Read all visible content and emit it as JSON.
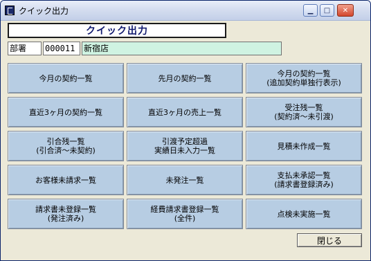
{
  "window": {
    "title": "クイック出力"
  },
  "header": {
    "title": "クイック出力"
  },
  "department": {
    "label": "部署",
    "code": "000011",
    "name": "新宿店"
  },
  "buttons": [
    {
      "line1": "今月の契約一覧",
      "line2": ""
    },
    {
      "line1": "先月の契約一覧",
      "line2": ""
    },
    {
      "line1": "今月の契約一覧",
      "line2": "(追加契約単独行表示)"
    },
    {
      "line1": "直近3ヶ月の契約一覧",
      "line2": ""
    },
    {
      "line1": "直近3ヶ月の売上一覧",
      "line2": ""
    },
    {
      "line1": "受注残一覧",
      "line2": "(契約済～未引渡)"
    },
    {
      "line1": "引合残一覧",
      "line2": "(引合済～未契約)"
    },
    {
      "line1": "引渡予定超過",
      "line2": "実績日未入力一覧"
    },
    {
      "line1": "見積未作成一覧",
      "line2": ""
    },
    {
      "line1": "お客様未請求一覧",
      "line2": ""
    },
    {
      "line1": "未発注一覧",
      "line2": ""
    },
    {
      "line1": "支払未承認一覧",
      "line2": "(請求書登録済み)"
    },
    {
      "line1": "請求書未登録一覧",
      "line2": "(発注済み)"
    },
    {
      "line1": "経費請求書登録一覧",
      "line2": "(全件)"
    },
    {
      "line1": "点検未実施一覧",
      "line2": ""
    }
  ],
  "footer": {
    "close_label": "閉じる"
  }
}
